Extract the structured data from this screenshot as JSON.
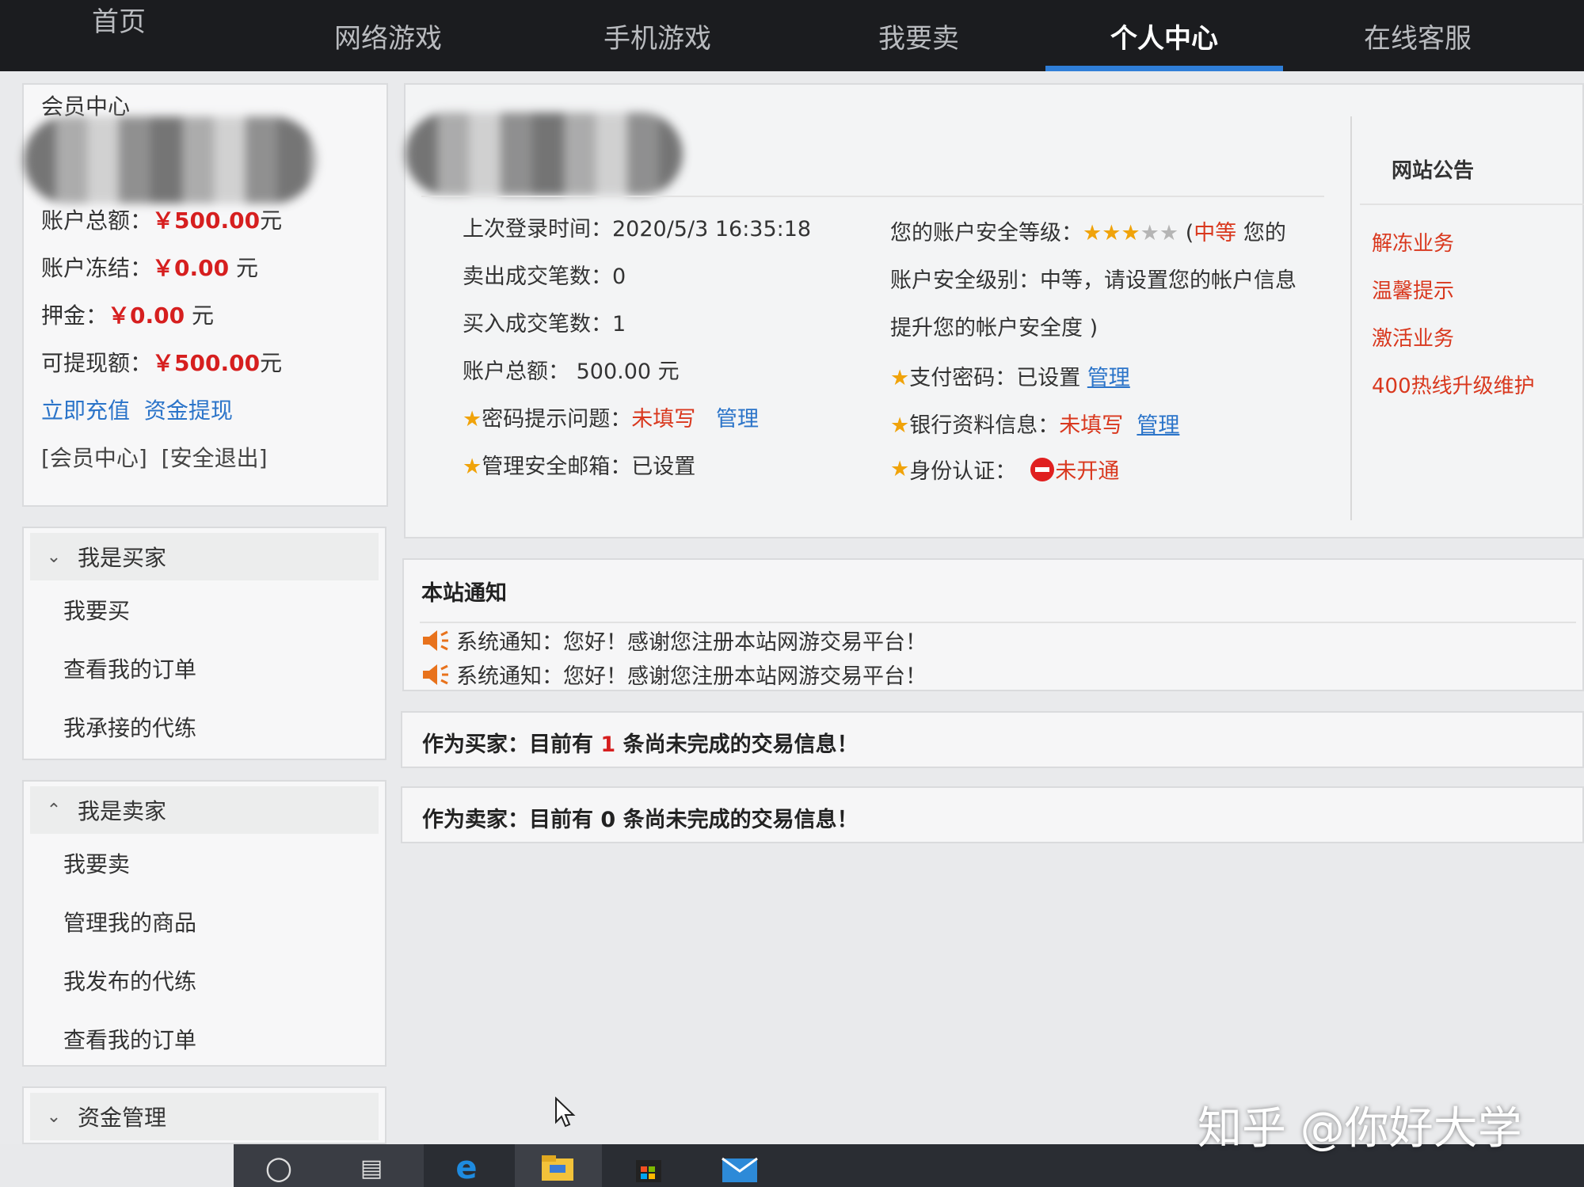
{
  "nav": {
    "items": [
      {
        "label": "首页",
        "active": false
      },
      {
        "label": "网络游戏",
        "active": false
      },
      {
        "label": "手机游戏",
        "active": false
      },
      {
        "label": "我要卖",
        "active": false
      },
      {
        "label": "个人中心",
        "active": true
      },
      {
        "label": "在线客服",
        "active": false
      }
    ]
  },
  "member": {
    "title": "会员中心",
    "total_label": "账户总额：",
    "total_value": "￥500.00",
    "total_unit": "元",
    "frozen_label": "账户冻结：",
    "frozen_value": "￥0.00",
    "frozen_unit": " 元",
    "deposit_label": "押金：",
    "deposit_value": "￥0.00",
    "deposit_unit": " 元",
    "withdrawable_label": "可提现额：",
    "withdrawable_value": "￥500.00",
    "withdrawable_unit": "元",
    "recharge_link": "立即充值",
    "withdraw_link": "资金提现",
    "center_link": "[会员中心]",
    "logout_link": "[安全退出]"
  },
  "buyer_menu": {
    "title": "我是买家",
    "items": [
      "我要买",
      "查看我的订单",
      "我承接的代练"
    ]
  },
  "seller_menu": {
    "title": "我是卖家",
    "items": [
      "我要卖",
      "管理我的商品",
      "我发布的代练",
      "查看我的订单"
    ]
  },
  "funds_menu": {
    "title": "资金管理"
  },
  "account": {
    "last_login_label": "上次登录时间：",
    "last_login_value": "2020/5/3 16:35:18",
    "sold_label": "卖出成交笔数：",
    "sold_value": "0",
    "bought_label": "买入成交笔数：",
    "bought_value": "1",
    "total_label": "账户总额：",
    "total_value": "500.00 元",
    "pw_question_label": "密码提示问题：",
    "pw_question_status": "未填写",
    "pw_question_manage": "管理",
    "email_label": "管理安全邮箱：",
    "email_status": "已设置"
  },
  "security": {
    "level_label": "您的账户安全等级：",
    "stars_filled": 3,
    "stars_total": 5,
    "level_open": "(",
    "level_value": "中等",
    "level_text1": " 您的",
    "level_line2": "账户安全级别：中等，请设置您的帐户信息",
    "level_line3": "提升您的帐户安全度 )",
    "pay_pw_label": "支付密码：",
    "pay_pw_status": "已设置",
    "pay_pw_manage": "管理",
    "bank_label": "银行资料信息：",
    "bank_status": "未填写",
    "bank_manage": "管理",
    "id_label": "身份认证：",
    "id_status": "未开通"
  },
  "announcements": {
    "title": "网站公告",
    "items": [
      "解冻业务",
      "温馨提示",
      "激活业务",
      "400热线升级维护"
    ]
  },
  "site_notice": {
    "title": "本站通知",
    "lines": [
      "系统通知：您好！感谢您注册本站网游交易平台！",
      "系统通知：您好！感谢您注册本站网游交易平台！"
    ]
  },
  "buyer_bar": {
    "prefix": "作为买家：目前有 ",
    "count": "1",
    "suffix": " 条尚未完成的交易信息！"
  },
  "seller_bar": {
    "prefix": "作为卖家：目前有 ",
    "count": "0",
    "suffix": " 条尚未完成的交易信息！"
  },
  "watermark": "知乎 @你好大学",
  "colors": {
    "nav_bg": "#1b1c1f",
    "accent_blue": "#2f7ed8",
    "money_red": "#d61f1f",
    "link_blue": "#2b74c9",
    "warn_red": "#d9381e",
    "star_gold": "#f0a30a"
  }
}
